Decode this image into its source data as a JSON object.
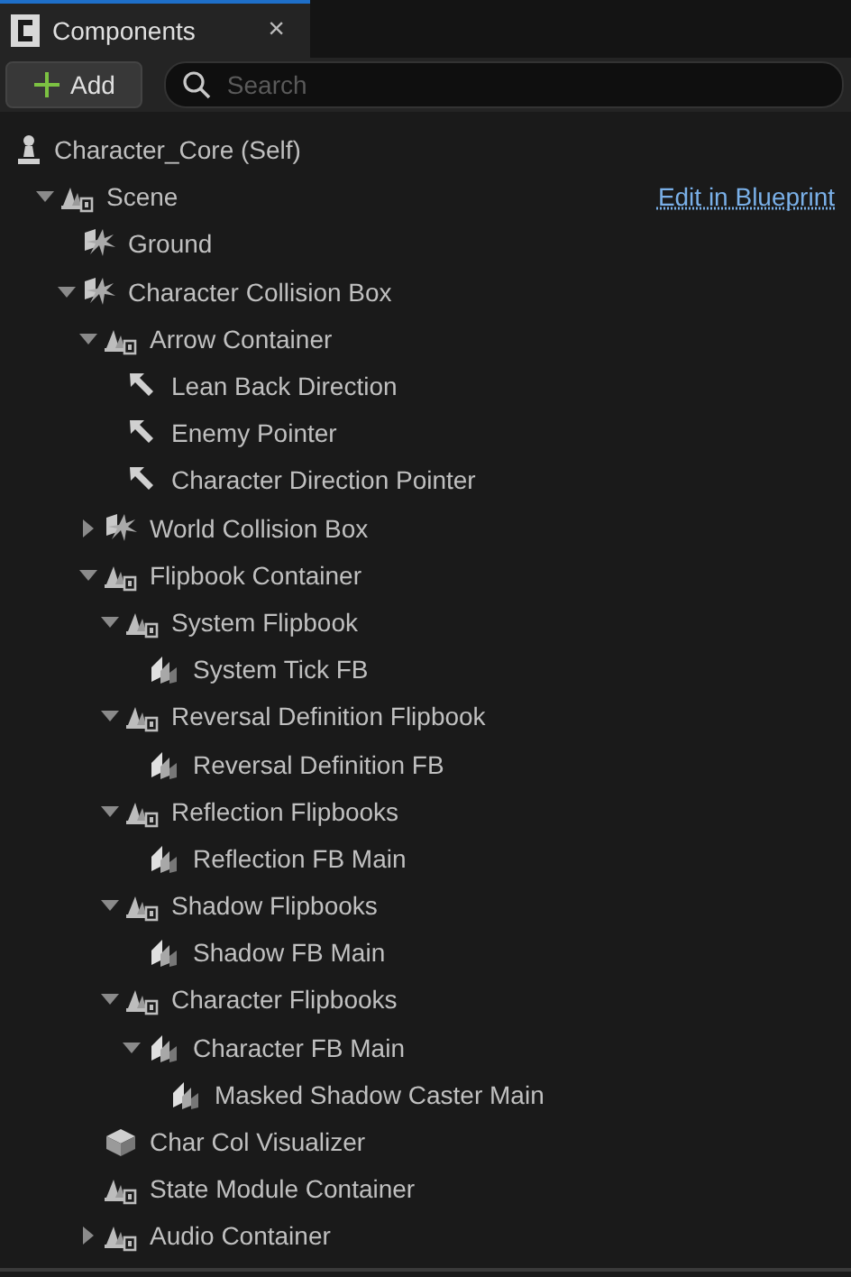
{
  "tab": {
    "title": "Components",
    "close": "×"
  },
  "toolbar": {
    "add_label": "Add",
    "search": {
      "placeholder": "Search"
    }
  },
  "root": {
    "label": "Character_Core (Self)",
    "kind": "pawn"
  },
  "edit_link": "Edit in Blueprint",
  "tree": [
    {
      "label": "Scene",
      "kind": "scene",
      "expanded": true,
      "children": [
        {
          "label": "Ground",
          "kind": "collision"
        },
        {
          "label": "Character Collision Box",
          "kind": "collision",
          "expanded": true,
          "children": [
            {
              "label": "Arrow Container",
              "kind": "scene",
              "expanded": true,
              "children": [
                {
                  "label": "Lean Back Direction",
                  "kind": "arrow"
                },
                {
                  "label": "Enemy Pointer",
                  "kind": "arrow"
                },
                {
                  "label": "Character Direction Pointer",
                  "kind": "arrow"
                }
              ]
            },
            {
              "label": "World Collision Box",
              "kind": "collision",
              "expanded": false
            },
            {
              "label": "Flipbook Container",
              "kind": "scene",
              "expanded": true,
              "children": [
                {
                  "label": "System Flipbook",
                  "kind": "scene",
                  "expanded": true,
                  "children": [
                    {
                      "label": "System Tick FB",
                      "kind": "sprite"
                    }
                  ]
                },
                {
                  "label": "Reversal Definition Flipbook",
                  "kind": "scene",
                  "expanded": true,
                  "children": [
                    {
                      "label": "Reversal Definition FB",
                      "kind": "sprite"
                    }
                  ]
                },
                {
                  "label": "Reflection Flipbooks",
                  "kind": "scene",
                  "expanded": true,
                  "children": [
                    {
                      "label": "Reflection FB Main",
                      "kind": "sprite"
                    }
                  ]
                },
                {
                  "label": "Shadow Flipbooks",
                  "kind": "scene",
                  "expanded": true,
                  "children": [
                    {
                      "label": "Shadow FB Main",
                      "kind": "sprite"
                    }
                  ]
                },
                {
                  "label": "Character Flipbooks",
                  "kind": "scene",
                  "expanded": true,
                  "children": [
                    {
                      "label": "Character FB Main",
                      "kind": "sprite",
                      "expanded": true,
                      "children": [
                        {
                          "label": "Masked Shadow Caster Main",
                          "kind": "sprite"
                        }
                      ]
                    }
                  ]
                }
              ]
            },
            {
              "label": "Char Col Visualizer",
              "kind": "cube"
            },
            {
              "label": "State Module Container",
              "kind": "scene"
            },
            {
              "label": "Audio Container",
              "kind": "scene",
              "expanded": false
            }
          ]
        }
      ]
    }
  ]
}
